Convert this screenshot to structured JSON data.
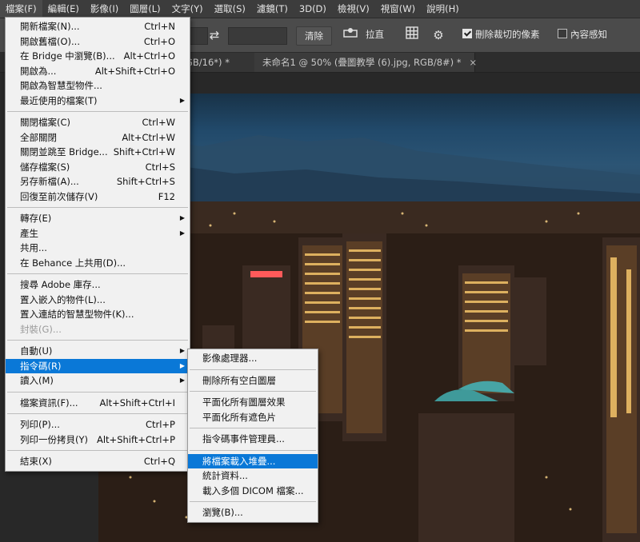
{
  "menubar": {
    "items": [
      "檔案(F)",
      "編輯(E)",
      "影像(I)",
      "圖層(L)",
      "文字(Y)",
      "選取(S)",
      "濾鏡(T)",
      "3D(D)",
      "檢視(V)",
      "視窗(W)",
      "說明(H)"
    ]
  },
  "options": {
    "clear_label": "清除",
    "straighten_label": "拉直",
    "delete_cropped_label": "刪除裁切的像素",
    "delete_cropped_checked": true,
    "content_aware_label": "內容感知",
    "content_aware_checked": false
  },
  "tabs": [
    {
      "label": "GB/16*) *",
      "close": "×"
    },
    {
      "label": "未命名1 @ 50% (疊圖教學 (6).jpg, RGB/8#) *",
      "close": "×"
    }
  ],
  "file_menu": {
    "groups": [
      [
        {
          "label": "開新檔案(N)...",
          "shortcut": "Ctrl+N"
        },
        {
          "label": "開啟舊檔(O)...",
          "shortcut": "Ctrl+O"
        },
        {
          "label": "在 Bridge 中瀏覽(B)...",
          "shortcut": "Alt+Ctrl+O"
        },
        {
          "label": "開啟為...",
          "shortcut": "Alt+Shift+Ctrl+O"
        },
        {
          "label": "開啟為智慧型物件...",
          "shortcut": ""
        },
        {
          "label": "最近使用的檔案(T)",
          "shortcut": "",
          "submenu": true
        }
      ],
      [
        {
          "label": "關閉檔案(C)",
          "shortcut": "Ctrl+W"
        },
        {
          "label": "全部關閉",
          "shortcut": "Alt+Ctrl+W"
        },
        {
          "label": "關閉並跳至 Bridge...",
          "shortcut": "Shift+Ctrl+W"
        },
        {
          "label": "儲存檔案(S)",
          "shortcut": "Ctrl+S"
        },
        {
          "label": "另存新檔(A)...",
          "shortcut": "Shift+Ctrl+S"
        },
        {
          "label": "回復至前次儲存(V)",
          "shortcut": "F12"
        }
      ],
      [
        {
          "label": "轉存(E)",
          "shortcut": "",
          "submenu": true
        },
        {
          "label": "產生",
          "shortcut": "",
          "submenu": true
        },
        {
          "label": "共用...",
          "shortcut": ""
        },
        {
          "label": "在 Behance 上共用(D)...",
          "shortcut": ""
        }
      ],
      [
        {
          "label": "搜尋 Adobe 庫存...",
          "shortcut": ""
        },
        {
          "label": "置入嵌入的物件(L)...",
          "shortcut": ""
        },
        {
          "label": "置入連結的智慧型物件(K)...",
          "shortcut": ""
        },
        {
          "label": "封裝(G)...",
          "shortcut": "",
          "disabled": true
        }
      ],
      [
        {
          "label": "自動(U)",
          "shortcut": "",
          "submenu": true
        },
        {
          "label": "指令碼(R)",
          "shortcut": "",
          "submenu": true,
          "highlight": true
        },
        {
          "label": "讀入(M)",
          "shortcut": "",
          "submenu": true
        }
      ],
      [
        {
          "label": "檔案資訊(F)...",
          "shortcut": "Alt+Shift+Ctrl+I"
        }
      ],
      [
        {
          "label": "列印(P)...",
          "shortcut": "Ctrl+P"
        },
        {
          "label": "列印一份拷貝(Y)",
          "shortcut": "Alt+Shift+Ctrl+P"
        }
      ],
      [
        {
          "label": "結束(X)",
          "shortcut": "Ctrl+Q"
        }
      ]
    ]
  },
  "scripts_menu": {
    "groups": [
      [
        {
          "label": "影像處理器..."
        }
      ],
      [
        {
          "label": "刪除所有空白圖層"
        }
      ],
      [
        {
          "label": "平面化所有圖層效果"
        },
        {
          "label": "平面化所有遮色片"
        }
      ],
      [
        {
          "label": "指令碼事件管理員..."
        }
      ],
      [
        {
          "label": "將檔案載入堆疊...",
          "highlight": true
        },
        {
          "label": "統計資料..."
        },
        {
          "label": "載入多個 DICOM 檔案..."
        }
      ],
      [
        {
          "label": "瀏覽(B)..."
        }
      ]
    ]
  },
  "icons": {
    "swap": "swap-arrows-icon",
    "straighten": "straighten-icon",
    "grid": "grid-overlay-icon",
    "gear": "gear-icon",
    "submenu": "submenu-arrow-icon"
  }
}
